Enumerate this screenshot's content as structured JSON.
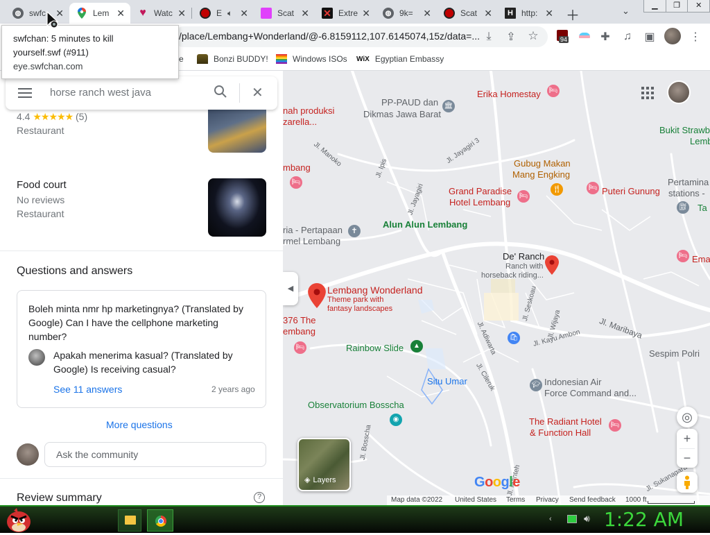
{
  "tabs": [
    {
      "title": "swfc",
      "favicon": "globe-icon"
    },
    {
      "title": "Lem",
      "favicon": "google-maps-icon"
    },
    {
      "title": "Watc",
      "favicon": "heart-icon"
    },
    {
      "title": "E",
      "favicon": "red-circle-icon"
    },
    {
      "title": "Scat",
      "favicon": "pink-square-icon"
    },
    {
      "title": "Extre",
      "favicon": "red-x-icon"
    },
    {
      "title": "9k=",
      "favicon": "globe-icon"
    },
    {
      "title": "Scat",
      "favicon": "red-circle-icon"
    },
    {
      "title": "http:",
      "favicon": "h-icon"
    }
  ],
  "tooltip": {
    "title_line1": "swfchan: 5 minutes to kill",
    "title_line2": "yourself.swf (#911)",
    "domain": "eye.swfchan.com"
  },
  "address_bar": {
    "url": "/place/Lembang+Wonderland/@-6.8159112,107.6145074,15z/data=..."
  },
  "extension_badge": "94",
  "bookmarks": [
    {
      "label": "e"
    },
    {
      "label": "Bonzi BUDDY!"
    },
    {
      "label": "Windows ISOs"
    },
    {
      "label": "Egyptian Embassy"
    }
  ],
  "search": {
    "placeholder": "horse ranch west java"
  },
  "results": [
    {
      "rating": "4.4",
      "stars": "★★★★★",
      "reviews": "(5)",
      "category": "Restaurant"
    },
    {
      "name": "Food court",
      "reviews": "No reviews",
      "category": "Restaurant"
    }
  ],
  "qa": {
    "heading": "Questions and answers",
    "question": "Boleh minta nmr hp marketingnya? (Translated by Google) Can I have the cellphone marketing number?",
    "answer": "Apakah menerima kasual? (Translated by Google) Is receiving casual?",
    "see_answers": "See 11 answers",
    "age": "2 years ago",
    "more": "More questions",
    "ask_placeholder": "Ask the community"
  },
  "review_summary": "Review summary",
  "map": {
    "labels": [
      {
        "text": "Erika Homestay",
        "kind": "red"
      },
      {
        "text": "PP-PAUD dan",
        "kind": "grey"
      },
      {
        "text": "Dikmas Jawa Barat",
        "kind": "grey"
      },
      {
        "text": "nah produksi",
        "kind": "red"
      },
      {
        "text": "zarella...",
        "kind": "red"
      },
      {
        "text": "Gubug Makan",
        "kind": "orange"
      },
      {
        "text": "Mang Engking",
        "kind": "orange"
      },
      {
        "text": "Bukit Strawb",
        "kind": "green"
      },
      {
        "text": "Lemb",
        "kind": "green"
      },
      {
        "text": "mbang",
        "kind": "red"
      },
      {
        "text": "Grand Paradise",
        "kind": "red"
      },
      {
        "text": "Hotel Lembang",
        "kind": "red"
      },
      {
        "text": "Puteri Gunung",
        "kind": "red"
      },
      {
        "text": "Pertamina",
        "kind": "grey"
      },
      {
        "text": "stations -",
        "kind": "grey"
      },
      {
        "text": "Ta",
        "kind": "green"
      },
      {
        "text": "ria - Pertapaan",
        "kind": "grey"
      },
      {
        "text": "rmel Lembang",
        "kind": "grey"
      },
      {
        "text": "Alun Alun Lembang",
        "kind": "green"
      },
      {
        "text": "De' Ranch",
        "kind": "dark"
      },
      {
        "text": "Ranch with",
        "kind": "grey"
      },
      {
        "text": "horseback riding...",
        "kind": "grey"
      },
      {
        "text": "Ema",
        "kind": "red"
      },
      {
        "text": "Lembang Wonderland",
        "kind": "red"
      },
      {
        "text": "Theme park with",
        "kind": "red"
      },
      {
        "text": "fantasy landscapes",
        "kind": "red"
      },
      {
        "text": "376 The",
        "kind": "red"
      },
      {
        "text": "embang",
        "kind": "red"
      },
      {
        "text": "Rainbow Slide",
        "kind": "green"
      },
      {
        "text": "Sespim Polri",
        "kind": "grey"
      },
      {
        "text": "Situ Umar",
        "kind": "blue"
      },
      {
        "text": "Indonesian Air",
        "kind": "grey"
      },
      {
        "text": "Force Command and...",
        "kind": "grey"
      },
      {
        "text": "Observatorium Bosscha",
        "kind": "green"
      },
      {
        "text": "The Radiant Hotel",
        "kind": "red"
      },
      {
        "text": "& Function Hall",
        "kind": "red"
      }
    ],
    "roads": [
      "Jl. Manoko",
      "Jl. Jayagiri 3",
      "Jl. Ipis",
      "Jl. Jayagiri",
      "Jl. Seskoau",
      "Jl. Wijaya",
      "Jl. Maribaya",
      "Jl. Kayu Ambon",
      "Jl. Adiwarta",
      "Jl. Cileruk",
      "Jl. Bosscha",
      "Jl. Sukanagara",
      "Jl. Manteh"
    ],
    "layers_label": "Layers",
    "google": "Google",
    "footer": [
      "Map data ©2022",
      "United States",
      "Terms",
      "Privacy",
      "Send feedback",
      "1000 ft"
    ]
  },
  "clock": "1:22 AM",
  "colors": {
    "accent": "#1a73e8",
    "clock": "#3cd83c",
    "taskbar": "#050805"
  }
}
